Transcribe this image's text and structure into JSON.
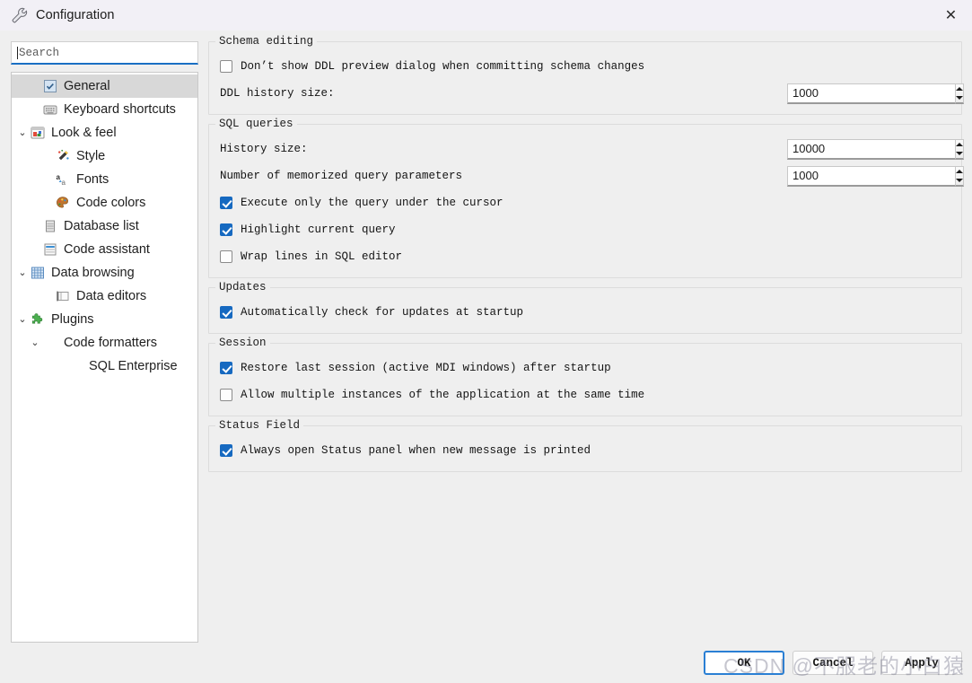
{
  "window": {
    "title": "Configuration",
    "icon": "wrench-icon",
    "close_label": "✕"
  },
  "search": {
    "placeholder": "Search",
    "value": ""
  },
  "tree": {
    "items": [
      {
        "label": "General",
        "icon": "checkbox-general-icon",
        "depth": 1,
        "twisty": "",
        "selected": true
      },
      {
        "label": "Keyboard shortcuts",
        "icon": "keyboard-icon",
        "depth": 1,
        "twisty": "",
        "selected": false
      },
      {
        "label": "Look & feel",
        "icon": "look-and-feel-icon",
        "depth": 0,
        "twisty": "⌄",
        "selected": false
      },
      {
        "label": "Style",
        "icon": "magic-wand-icon",
        "depth": 2,
        "twisty": "",
        "selected": false
      },
      {
        "label": "Fonts",
        "icon": "fonts-icon",
        "depth": 2,
        "twisty": "",
        "selected": false
      },
      {
        "label": "Code colors",
        "icon": "palette-icon",
        "depth": 2,
        "twisty": "",
        "selected": false
      },
      {
        "label": "Database list",
        "icon": "database-icon",
        "depth": 1,
        "twisty": "",
        "selected": false
      },
      {
        "label": "Code assistant",
        "icon": "code-assistant-icon",
        "depth": 1,
        "twisty": "",
        "selected": false
      },
      {
        "label": "Data browsing",
        "icon": "grid-icon",
        "depth": 0,
        "twisty": "⌄",
        "selected": false
      },
      {
        "label": "Data editors",
        "icon": "data-editor-icon",
        "depth": 2,
        "twisty": "",
        "selected": false
      },
      {
        "label": "Plugins",
        "icon": "puzzle-icon",
        "depth": 0,
        "twisty": "⌄",
        "selected": false
      },
      {
        "label": "Code formatters",
        "icon": "none",
        "depth": 1,
        "twisty": "⌄",
        "selected": false
      },
      {
        "label": "SQL Enterprise",
        "icon": "none",
        "depth": 3,
        "twisty": "",
        "selected": false
      }
    ]
  },
  "groups": {
    "schema_editing": {
      "title": "Schema editing",
      "dont_show_ddl": {
        "label": "Don’t show DDL preview dialog when committing schema changes",
        "checked": false
      },
      "ddl_history": {
        "label": "DDL history size:",
        "value": "1000"
      }
    },
    "sql_queries": {
      "title": "SQL queries",
      "history_size": {
        "label": "History size:",
        "value": "10000"
      },
      "memorized_params": {
        "label": "Number of memorized query parameters",
        "value": "1000"
      },
      "execute_under_cursor": {
        "label": "Execute only the query under the cursor",
        "checked": true
      },
      "highlight_current": {
        "label": "Highlight current query",
        "checked": true
      },
      "wrap_lines": {
        "label": "Wrap lines in SQL editor",
        "checked": false
      }
    },
    "updates": {
      "title": "Updates",
      "auto_check": {
        "label": "Automatically check for updates at startup",
        "checked": true
      }
    },
    "session": {
      "title": "Session",
      "restore_last": {
        "label": "Restore last session (active MDI windows) after startup",
        "checked": true
      },
      "allow_multiple": {
        "label": "Allow multiple instances of the application at the same time",
        "checked": false
      }
    },
    "status_field": {
      "title": "Status Field",
      "always_open": {
        "label": "Always open Status panel when new message is printed",
        "checked": true
      }
    }
  },
  "footer": {
    "ok": "OK",
    "cancel": "Cancel",
    "apply": "Apply"
  },
  "watermark": "CSDN @不服老的小白猿",
  "colors": {
    "accent": "#1669c0",
    "focus_border": "#2a7fd4",
    "titlebar_bg": "#f2f0f6",
    "panel_bg": "#efefef"
  }
}
